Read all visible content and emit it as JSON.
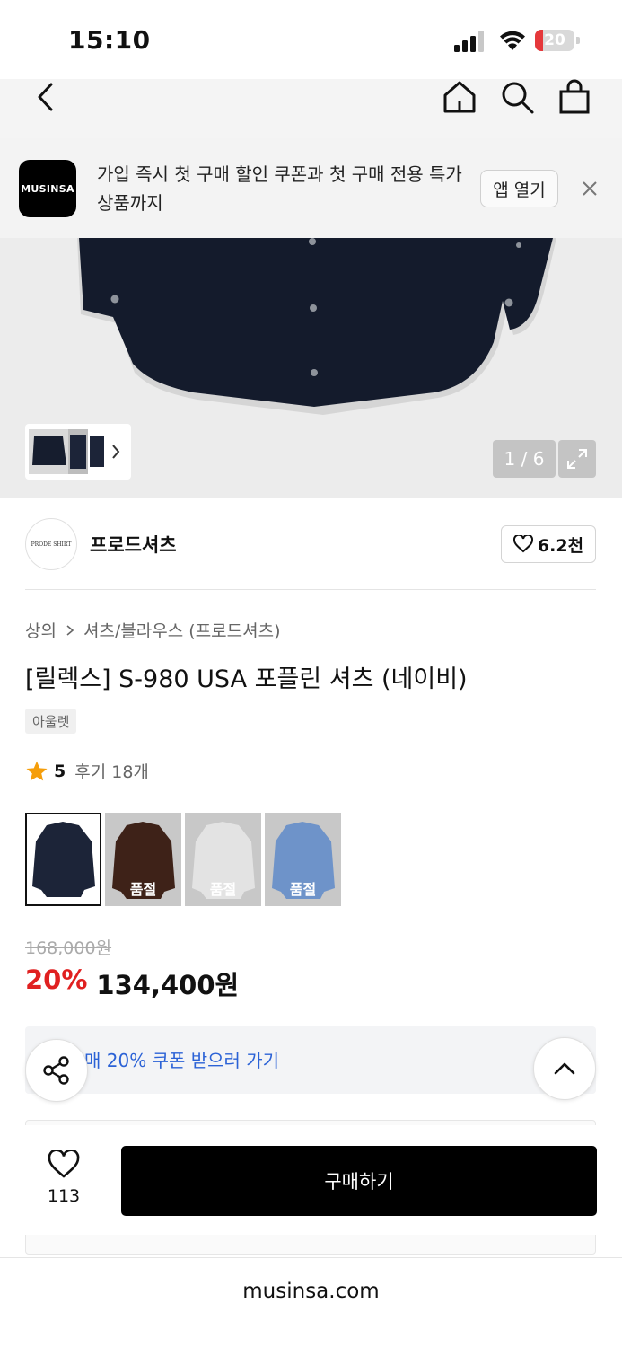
{
  "status_bar": {
    "time": "15:10",
    "battery_level": "20",
    "battery_fraction": 0.2
  },
  "banner": {
    "logo_text": "MUSINSA",
    "message": "가입 즉시 첫 구매 할인 쿠폰과 첫 구매 전용 특가 상품까지",
    "open_app_label": "앱 열기"
  },
  "gallery": {
    "counter": "1 / 6"
  },
  "brand": {
    "logo_text": "PRODE SHIRT",
    "name": "프로드셔츠",
    "likes": "6.2천"
  },
  "breadcrumb": {
    "category": "상의",
    "subcategory": "셔츠/블라우스 (프로드셔츠)"
  },
  "product": {
    "title": "[릴렉스] S-980 USA 포플린 셔츠 (네이비)",
    "badge": "아울렛",
    "rating": "5",
    "reviews_label": "후기 18개",
    "colors": [
      {
        "color": "#1c2438",
        "sold_out_label": ""
      },
      {
        "color": "#3e2218",
        "sold_out_label": "품절"
      },
      {
        "color": "#e3e3e3",
        "sold_out_label": "품절"
      },
      {
        "color": "#6e93c9",
        "sold_out_label": "품절"
      }
    ],
    "original_price": "168,000원",
    "discount_rate": "20%",
    "sale_price": "134,400원"
  },
  "coupon": {
    "text": "매 20% 쿠폰 받으러 가기"
  },
  "bottom": {
    "wish_count": "113",
    "buy_label": "구매하기"
  },
  "browser": {
    "url": "musinsa.com"
  },
  "colors": {
    "accent_red": "#e02020",
    "link_blue": "#2b62d6",
    "star": "#f59e0b"
  }
}
